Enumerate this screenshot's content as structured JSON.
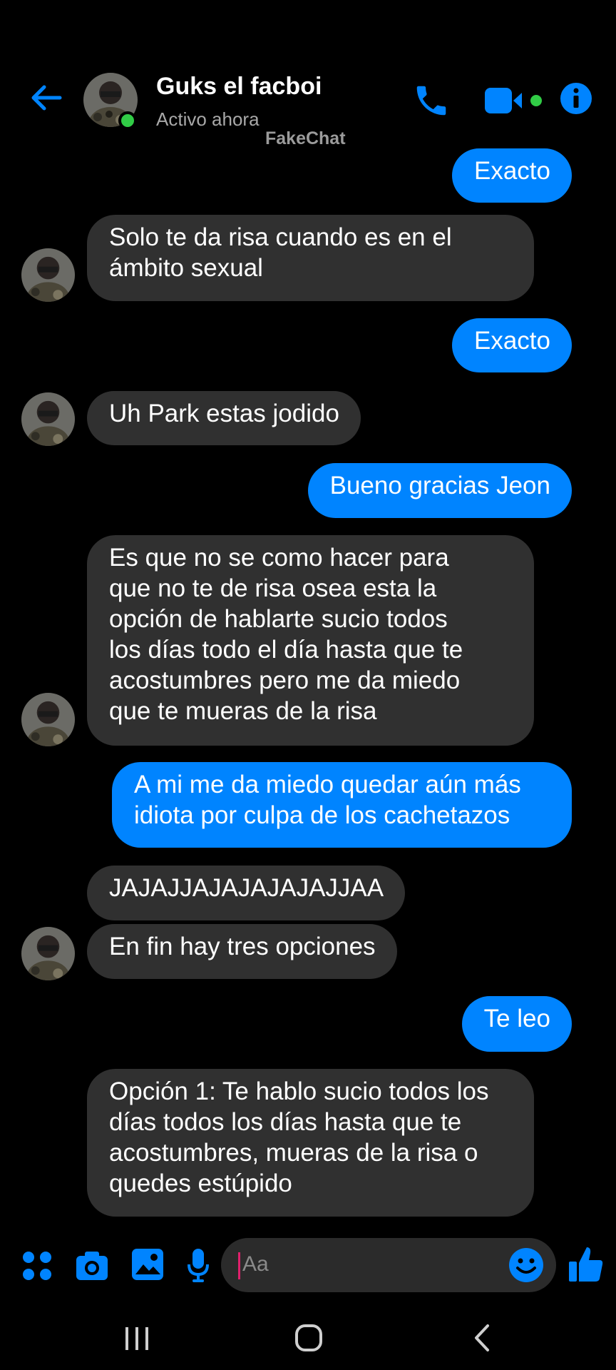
{
  "header": {
    "contact_name": "Guks el facboi",
    "status": "Activo ahora",
    "watermark": "FakeChat",
    "back_icon": "back-arrow-icon",
    "call_icon": "phone-icon",
    "video_icon": "video-camera-icon",
    "info_icon": "info-icon"
  },
  "messages": [
    {
      "direction": "out",
      "text": "Exacto"
    },
    {
      "direction": "in",
      "text": "Solo te da risa cuando es en el\námbito sexual"
    },
    {
      "direction": "out",
      "text": "Exacto"
    },
    {
      "direction": "in",
      "text": "Uh Park estas jodido"
    },
    {
      "direction": "out",
      "text": "Bueno gracias Jeon"
    },
    {
      "direction": "in",
      "text": "Es que no se como hacer para\nque no te de risa osea esta la\nopción de hablarte sucio todos\nlos días todo el día hasta que te\nacostumbres pero me da miedo\nque te mueras de la risa"
    },
    {
      "direction": "out",
      "text": "A mi me da miedo quedar aún más\nidiota por culpa de los cachetazos"
    },
    {
      "direction": "in",
      "text": "JAJAJJAJAJAJAJAJJAA"
    },
    {
      "direction": "in",
      "text": "En fin hay tres opciones"
    },
    {
      "direction": "out",
      "text": "Te leo"
    },
    {
      "direction": "in",
      "text": "Opción 1: Te hablo sucio todos los\ndías todos los días hasta que te\nacostumbres, mueras de la risa o\nquedes estúpido"
    }
  ],
  "composer": {
    "placeholder": "Aa",
    "icons": [
      "apps-icon",
      "camera-icon",
      "gallery-icon",
      "microphone-icon",
      "emoji-icon",
      "thumbs-up-icon"
    ]
  },
  "navbar": {
    "icons": [
      "recent-apps-icon",
      "home-icon",
      "back-icon"
    ]
  },
  "colors": {
    "background": "#000000",
    "outgoing_bubble": "#0084ff",
    "incoming_bubble": "#303030",
    "accent": "#0084ff",
    "online": "#31cc46"
  }
}
